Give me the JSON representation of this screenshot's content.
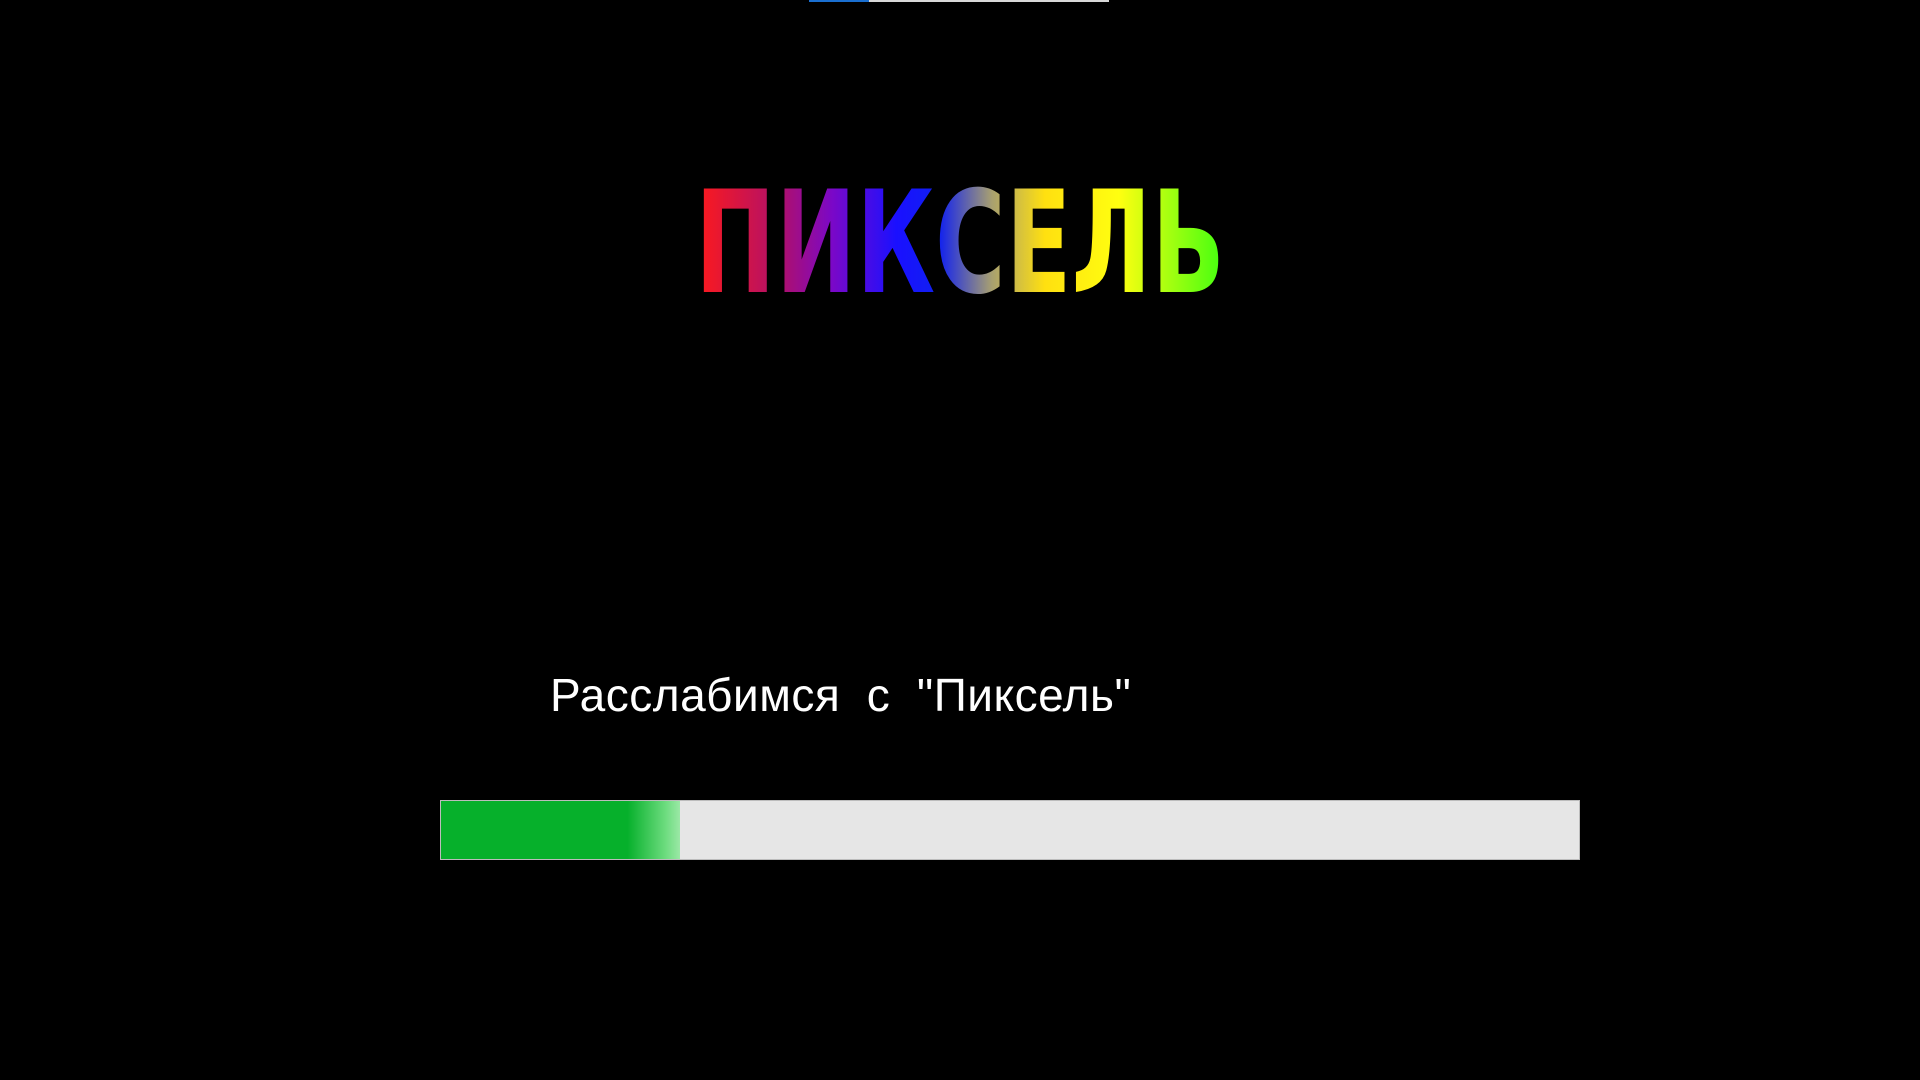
{
  "top_indicator": {
    "progress": 0.2,
    "fill_color": "#1a6fd0"
  },
  "logo": {
    "text": "ПИКСЕЛЬ",
    "gradient_colors": [
      "#ff1010",
      "#8a00c8",
      "#1010ff",
      "#ffff00",
      "#40ff10"
    ]
  },
  "loading": {
    "status_text": "Расслабимся  с  \"Пиксель\"",
    "progress": 0.21,
    "fill_color": "#06b02b",
    "track_color": "#e6e6e6"
  }
}
